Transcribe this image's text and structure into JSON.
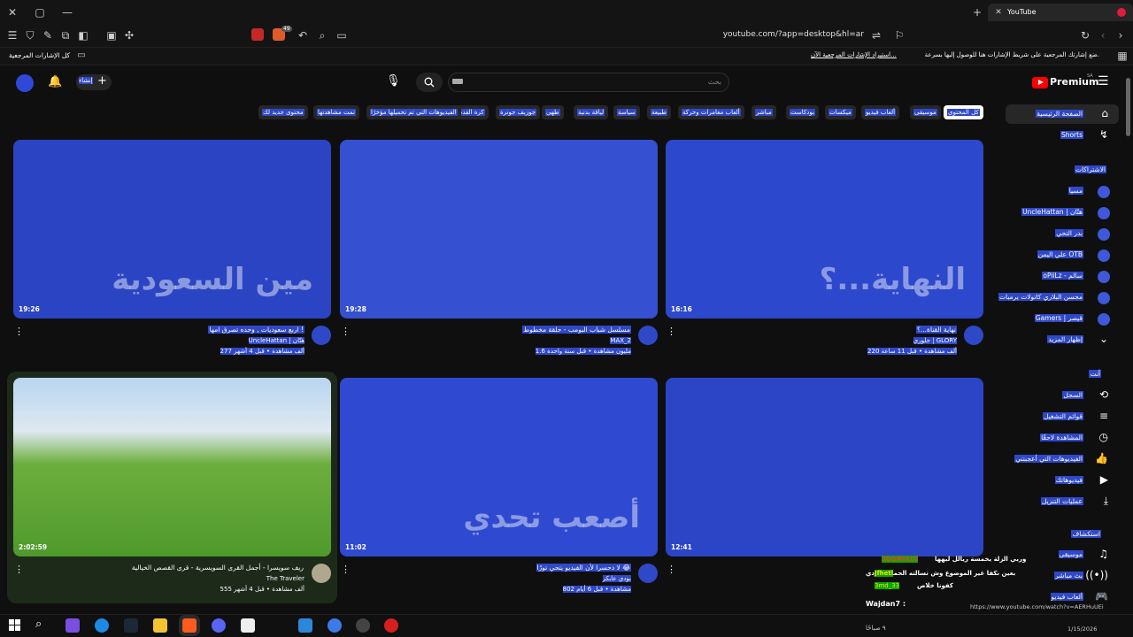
{
  "browser": {
    "tab_title": "YouTube",
    "address": "youtube.com/?app=desktop&hl=ar",
    "badge_count": "49",
    "bookmarks_left": "كل الإشارات المرجعية",
    "bookmarks_hint": "ضع إشارتك المرجعية على شريط الإشارات هنا للوصول إليها بسرعة.",
    "bookmarks_link": "استيراد الإشارات المرجعية الآن..."
  },
  "header": {
    "logo": "Premium",
    "logo_sup": "SA",
    "search_placeholder": "بحث",
    "create_label": "إنشاء"
  },
  "chips": [
    "كل المحتوى",
    "موسيقى",
    "ألعاب فيديو",
    "ميكسات",
    "بودكاست",
    "مباشر",
    "ألعاب مغامرات وحركة",
    "طبيعة",
    "سياسة",
    "لياقة بدنية",
    "طهي",
    "جوزيف جونرة",
    "كرة القدم",
    "الفيديوهات التي تم تحميلها مؤخرًا",
    "تمت مشاهدتها",
    "محتوى جديد لك"
  ],
  "sidebar": {
    "home": "الصفحة الرئيسية",
    "shorts": "Shorts",
    "subs_header": "الاشتراكات",
    "subs": [
      "مسيا",
      "UncleHattan | هتّان",
      "بدر التحي",
      "علي اليمن OTB",
      "oPiiLz - سالم",
      "محسن البلاري كاتولات يرمبات",
      "Gamers | قيصر"
    ],
    "show_more": "إظهار المزيد",
    "you_header": "أنت",
    "you_items": [
      "السجل",
      "قوائم التشغيل",
      "المشاهدة لاحقًا",
      "الفيديوهات التي أعجبتني",
      "فيديوهاتك",
      "عمليات التنزيل"
    ],
    "explore_header": "استكشاف",
    "explore_items": [
      "موسيقى",
      "بث مباشر",
      "ألعاب فيديو"
    ]
  },
  "videos": [
    {
      "title": "اربع سعوديات , وحده تصرق امها !",
      "channel": "UncleHattan | هتّان",
      "meta": "277 ألف مشاهدة • قبل 4 أشهر",
      "duration": "19:26",
      "thumb_text": "مين السعودية",
      "thumb_color": "#2a44c4"
    },
    {
      "title": "مسلسل شباب البومب - حلقة مخطوط",
      "channel": "MAX_2",
      "meta": "1.6 مليون مشاهدة • قبل سنة واحدة",
      "duration": "19:28",
      "thumb_text": "",
      "thumb_color": "#3550d0"
    },
    {
      "title": "نهاية القناة...؟",
      "channel": "جلوري | GLORY",
      "meta": "220 ألف مشاهدة • قبل 11 ساعة",
      "duration": "16:16",
      "thumb_text": "النهاية...؟",
      "thumb_color": "#2c48cc"
    },
    {
      "title": "ريف سويسرا - أجمل القرى السويسرية - قرى القصص الخيالية",
      "channel": "The Traveler",
      "meta": "555 ألف مشاهدة • قبل 4 أشهر",
      "duration": "2:02:59",
      "thumb_text": "",
      "thumb_color": "#5aa33c"
    },
    {
      "title": "لا دحسرا لأن الفيديو يتحي تورًا 😂",
      "channel": "بودي عابكر",
      "meta": "802 مشاهدة • قبل 6 أيام",
      "duration": "11:02",
      "thumb_text": "أصعب تحدي",
      "thumb_color": "#2f4ad0"
    },
    {
      "title": "",
      "channel": "",
      "meta": "",
      "duration": "12:41",
      "thumb_text": "",
      "thumb_color": "#2b45c6"
    }
  ],
  "overlay": {
    "lines": [
      "وربي الزلة يخمسة ريالل ليهها",
      "بعين نكفا غير الموضوع وش تسالته الحماسات دي",
      "دي التبويت",
      "كفونا خلاص"
    ],
    "names": [
      "3GGMIII10",
      "Jfhetl",
      "3md_33"
    ],
    "name_last": "Wajdan7 :",
    "url": "https://www.youtube.com/watch?v=AERHuUEi"
  },
  "taskbar": {
    "date": "1/15/2026",
    "time": "٩ صباحًا"
  },
  "colors": {
    "accent_blue": "#2f48c8",
    "yt_red": "#ff0000",
    "background": "#0f0f0f"
  }
}
